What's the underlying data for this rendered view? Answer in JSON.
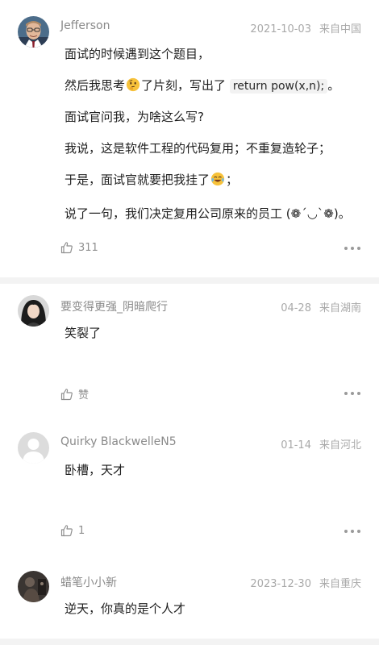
{
  "comments": [
    {
      "username": "Jefferson",
      "date": "2021-10-03",
      "location": "来自中国",
      "lines": {
        "l1": "面试的时候遇到这个题目，",
        "l2a": "然后我思考",
        "l2b": "了片刻，写出了",
        "l2code": "return pow(x,n);",
        "l2c": "。",
        "l3": "面试官问我，为啥这么写?",
        "l4": "我说，这是软件工程的代码复用；不重复造轮子；",
        "l5a": "于是，面试官就要把我挂了",
        "l5b": "；",
        "l6": "说了一句，我们决定复用公司原来的员工 (❁´◡`❁)。"
      },
      "likes": "311"
    },
    {
      "username": "要变得更强_阴暗爬行",
      "date": "04-28",
      "location": "来自湖南",
      "text": "笑裂了",
      "likes": "赞"
    },
    {
      "username": "Quirky BlackwelleN5",
      "date": "01-14",
      "location": "来自河北",
      "text": "卧槽，天才",
      "likes": "1"
    },
    {
      "username": "蜡笔小小新",
      "date": "2023-12-30",
      "location": "来自重庆",
      "text": "逆天，你真的是个人才"
    }
  ],
  "icons": {
    "like": "thumbs-up-icon",
    "more": "more-dots-icon",
    "thinking": "thinking-face-emoji",
    "laughing": "tears-of-joy-emoji"
  },
  "colors": {
    "meta_gray": "#a9a9a9",
    "username_gray": "#8a8a8a",
    "divider": "#f3f3f3"
  }
}
